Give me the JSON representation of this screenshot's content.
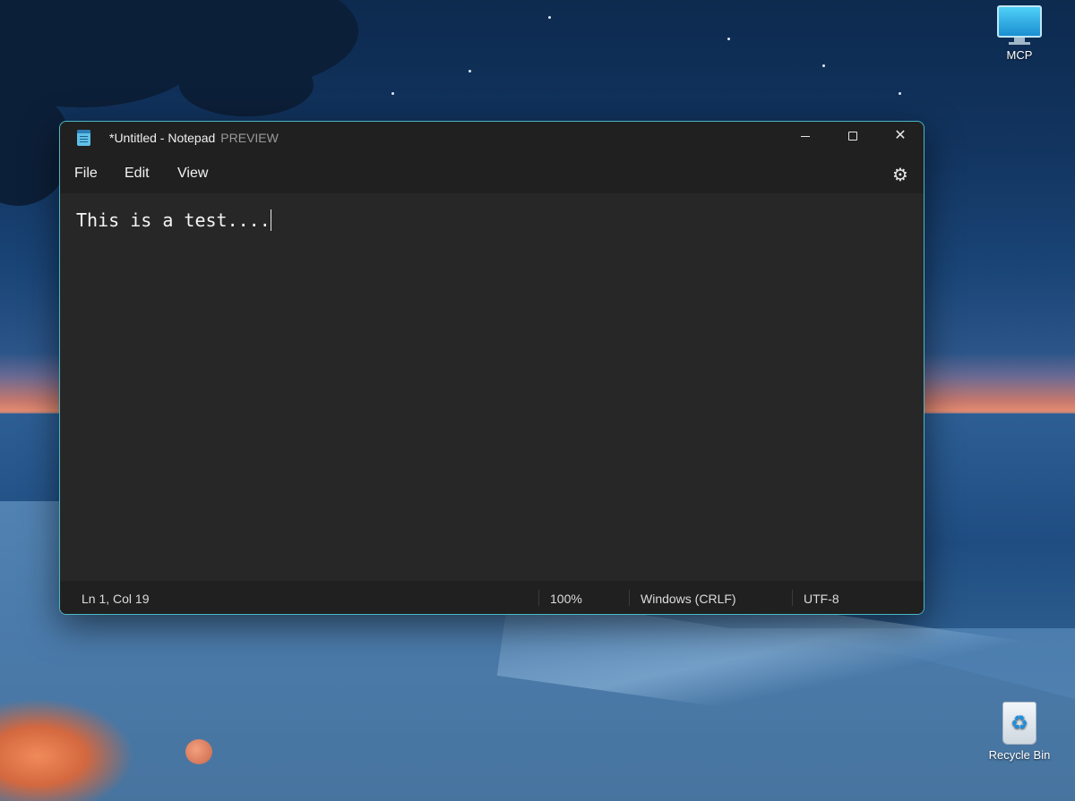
{
  "desktop": {
    "icons": [
      {
        "label": "MCP",
        "icon": "computer-monitor-icon"
      },
      {
        "label": "Recycle Bin",
        "icon": "recycle-bin-icon"
      }
    ]
  },
  "window": {
    "title": "*Untitled - Notepad",
    "preview_badge": "PREVIEW",
    "controls": {
      "minimize": "minimize-icon",
      "maximize": "maximize-icon",
      "close": "close-icon"
    }
  },
  "menu": {
    "file": "File",
    "edit": "Edit",
    "view": "View",
    "settings_icon": "gear-icon"
  },
  "editor": {
    "content": "This is a test...."
  },
  "status": {
    "position": "Ln 1, Col 19",
    "zoom": "100%",
    "line_ending": "Windows (CRLF)",
    "encoding": "UTF-8"
  },
  "colors": {
    "window_border": "#4ab8c4",
    "window_bg": "#202020",
    "editor_bg": "#272727"
  }
}
